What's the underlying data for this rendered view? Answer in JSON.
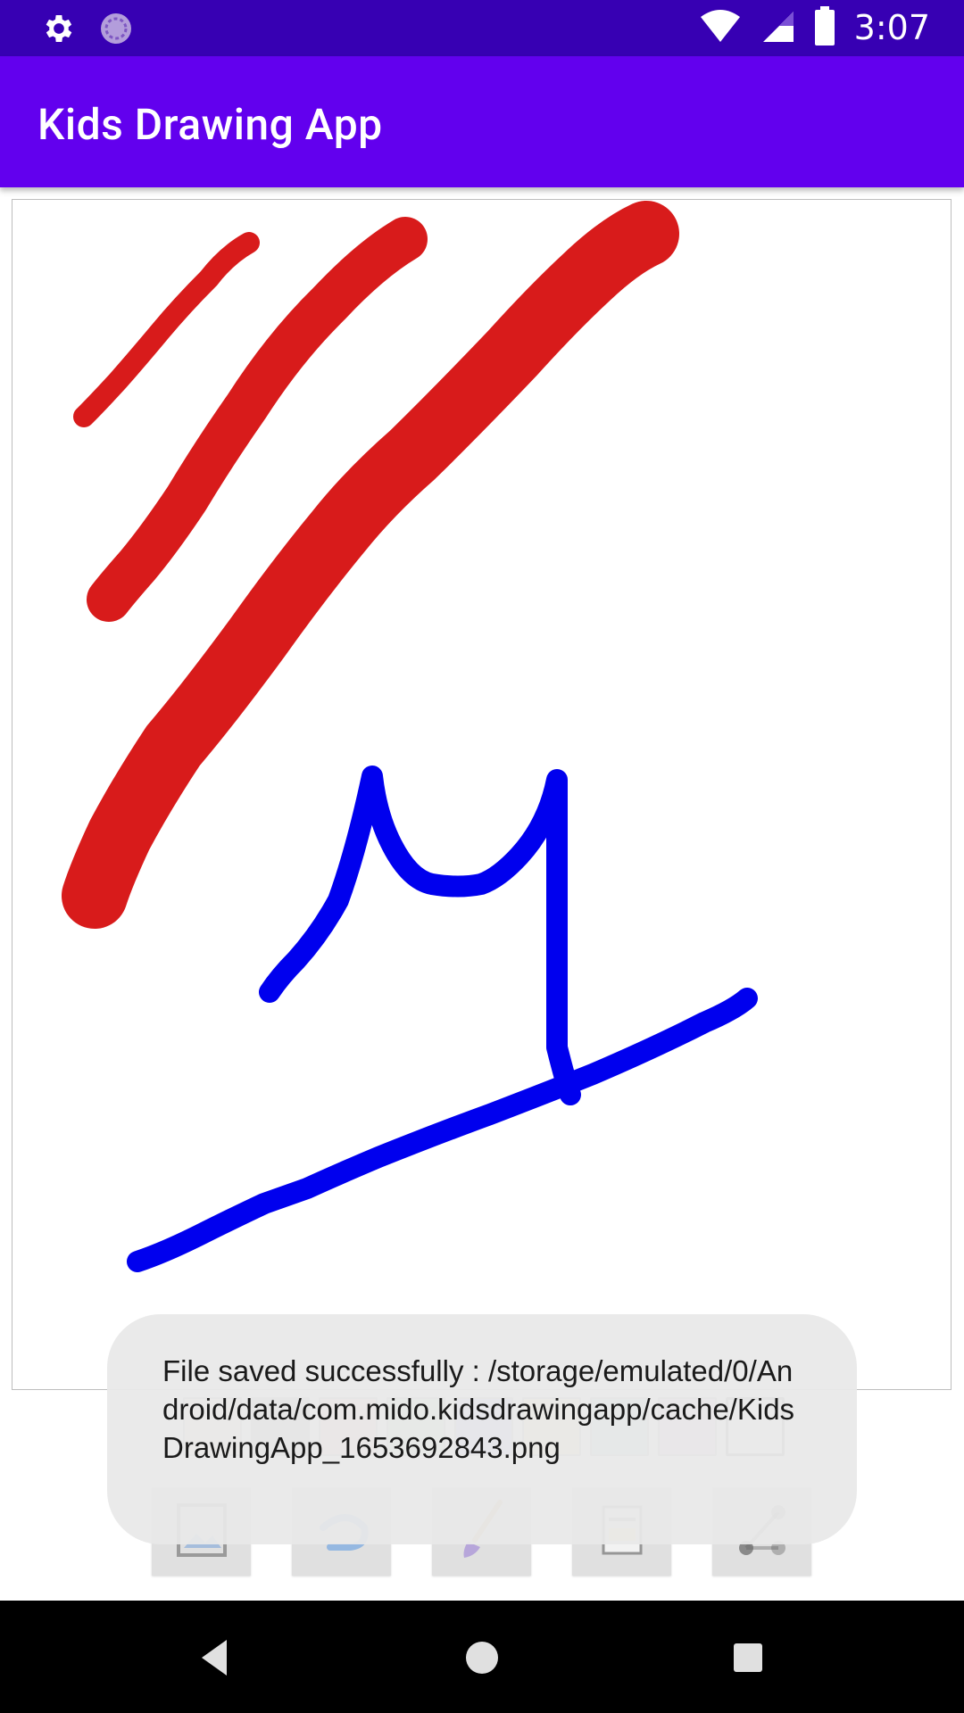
{
  "status_bar": {
    "time": "3:07",
    "icons_left": [
      "gear-icon",
      "sync-icon"
    ],
    "icons_right": [
      "wifi-icon",
      "signal-icon",
      "battery-icon"
    ]
  },
  "app_bar": {
    "title": "Kids Drawing App",
    "color": "#6200ee"
  },
  "canvas": {
    "strokes": [
      {
        "color": "#d81b1b",
        "desc": "thin-red-stroke"
      },
      {
        "color": "#d81b1b",
        "desc": "medium-red-stroke"
      },
      {
        "color": "#d81b1b",
        "desc": "thick-red-stroke"
      },
      {
        "color": "#0000ee",
        "desc": "blue-letter-stroke"
      },
      {
        "color": "#0000ee",
        "desc": "blue-underline-stroke"
      }
    ]
  },
  "palette": {
    "colors": [
      "#f8ede4",
      "#bdbdbd",
      "#f5d0cc",
      "#cfeecf",
      "#c8c8f7",
      "#f7f0bd",
      "#c4e3de",
      "#eccbec",
      "#ffffff"
    ]
  },
  "actions": {
    "buttons": [
      "gallery-icon",
      "undo-icon",
      "brush-icon",
      "save-icon",
      "share-icon"
    ]
  },
  "toast": {
    "message": "File saved successfully : /storage/emulated/0/Android/data/com.mido.kidsdrawingapp/cache/KidsDrawingApp_1653692843.png"
  },
  "nav_bar": {
    "buttons": [
      "back-icon",
      "home-icon",
      "recents-icon"
    ]
  }
}
